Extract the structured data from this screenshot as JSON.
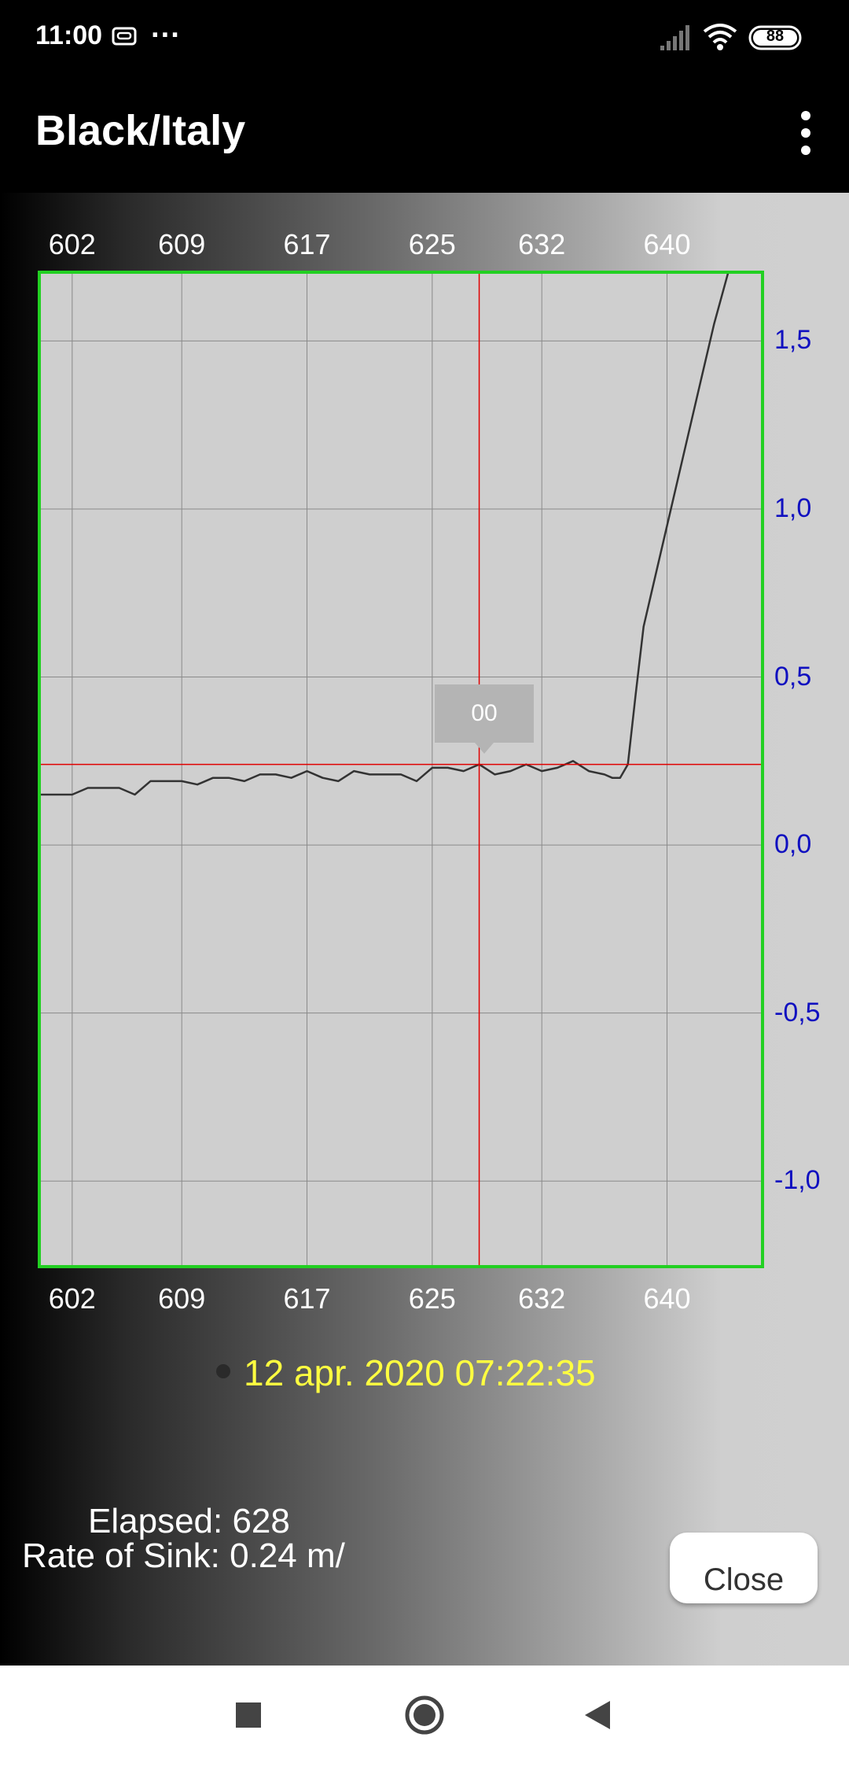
{
  "status": {
    "time": "11:00",
    "battery": "88",
    "dots": "···"
  },
  "app": {
    "title": "Black/Italy"
  },
  "chart_data": {
    "type": "line",
    "x_ticks": [
      "602",
      "609",
      "617",
      "625",
      "632",
      "640"
    ],
    "y_ticks": [
      "1,5",
      "1,0",
      "0,5",
      "0,0",
      "-0,5",
      "-1,0"
    ],
    "xlim": [
      600,
      646
    ],
    "ylim": [
      -1.25,
      1.7
    ],
    "crosshair": {
      "x": 628,
      "y": 0.24
    },
    "tooltip": "00",
    "series": [
      {
        "color": "#333333",
        "x": [
          600,
          601,
          602,
          603,
          604,
          605,
          606,
          607,
          608,
          609,
          610,
          611,
          612,
          613,
          614,
          615,
          616,
          617,
          618,
          619,
          620,
          621,
          622,
          623,
          624,
          625,
          626,
          627,
          628,
          629,
          630,
          631,
          632,
          633,
          634,
          635,
          636,
          636.5,
          637,
          637.5,
          638,
          638.5,
          639,
          640,
          641,
          642,
          643,
          644
        ],
        "y": [
          0.15,
          0.15,
          0.15,
          0.17,
          0.17,
          0.17,
          0.15,
          0.19,
          0.19,
          0.19,
          0.18,
          0.2,
          0.2,
          0.19,
          0.21,
          0.21,
          0.2,
          0.22,
          0.2,
          0.19,
          0.22,
          0.21,
          0.21,
          0.21,
          0.19,
          0.23,
          0.23,
          0.22,
          0.24,
          0.21,
          0.22,
          0.24,
          0.22,
          0.23,
          0.25,
          0.22,
          0.21,
          0.2,
          0.2,
          0.24,
          0.45,
          0.65,
          0.75,
          0.95,
          1.15,
          1.35,
          1.55,
          1.72
        ]
      }
    ]
  },
  "info": {
    "timestamp": "12 apr. 2020 07:22:35",
    "elapsed": "Elapsed: 628",
    "rate_of_sink": "Rate of Sink: 0.24 m/"
  },
  "buttons": {
    "close": "Close"
  }
}
